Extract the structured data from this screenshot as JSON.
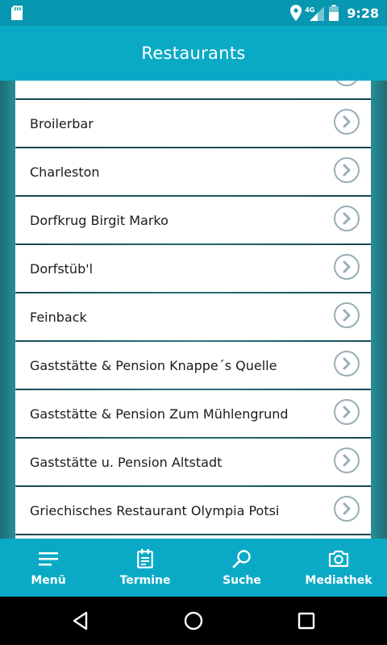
{
  "status_bar": {
    "time": "9:28",
    "network": "4G",
    "icons": [
      "sd-card-icon",
      "location-icon",
      "signal-icon",
      "battery-icon"
    ]
  },
  "app_bar": {
    "title": "Restaurants"
  },
  "restaurants": [
    {
      "name": ""
    },
    {
      "name": "Broilerbar"
    },
    {
      "name": "Charleston"
    },
    {
      "name": "Dorfkrug Birgit Marko"
    },
    {
      "name": "Dorfstüb'l"
    },
    {
      "name": "Feinback"
    },
    {
      "name": "Gaststätte & Pension Knappe´s Quelle"
    },
    {
      "name": "Gaststätte & Pension Zum Mühlengrund"
    },
    {
      "name": "Gaststätte u. Pension Altstadt"
    },
    {
      "name": "Griechisches Restaurant Olympia Potsi"
    },
    {
      "name": ""
    }
  ],
  "bottom_nav": [
    {
      "label": "Menü",
      "icon": "menu-icon"
    },
    {
      "label": "Termine",
      "icon": "calendar-icon"
    },
    {
      "label": "Suche",
      "icon": "search-icon"
    },
    {
      "label": "Mediathek",
      "icon": "camera-icon"
    }
  ],
  "colors": {
    "primary": "#0aaac6",
    "status_bar": "#0897b0",
    "chevron": "#98aeb6"
  }
}
